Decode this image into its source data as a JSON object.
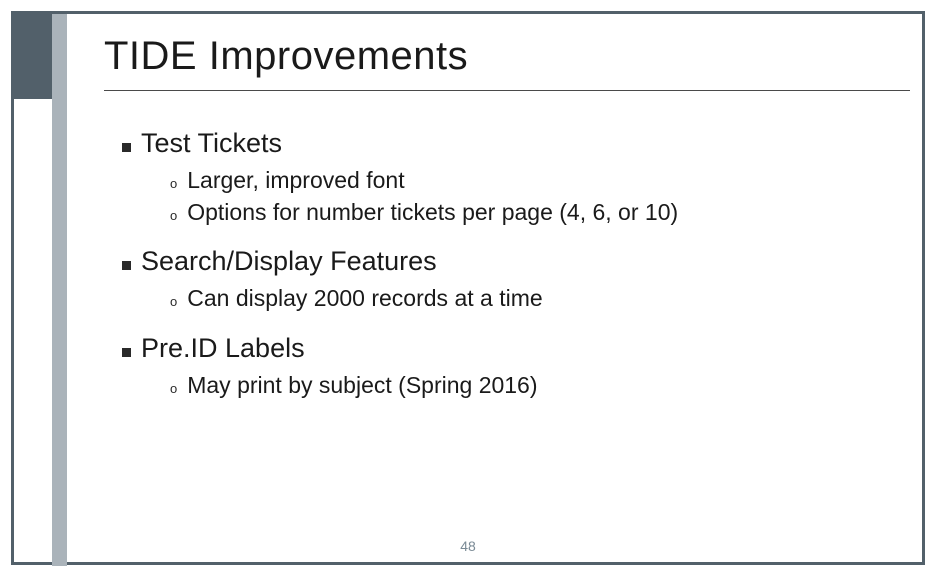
{
  "title": "TIDE Improvements",
  "sections": [
    {
      "heading": "Test Tickets",
      "items": [
        "Larger, improved font",
        "Options for number tickets per page (4, 6, or 10)"
      ]
    },
    {
      "heading": "Search/Display Features",
      "items": [
        "Can display 2000 records at a time"
      ]
    },
    {
      "heading": "Pre.ID Labels",
      "items": [
        "May print by subject (Spring 2016)"
      ]
    }
  ],
  "page_number": "48"
}
